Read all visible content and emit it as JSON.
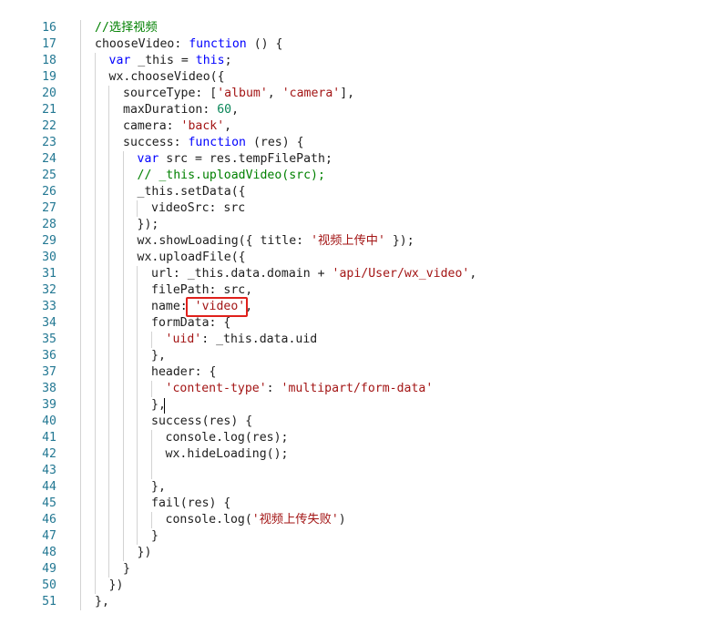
{
  "editor": {
    "lines": [
      {
        "num": "16",
        "indent": 0,
        "tokens": [
          {
            "t": "//选择视频",
            "c": "cm"
          }
        ]
      },
      {
        "num": "17",
        "indent": 0,
        "tokens": [
          {
            "t": "chooseVideo: ",
            "c": "txt"
          },
          {
            "t": "function",
            "c": "kw"
          },
          {
            "t": " () {",
            "c": "txt"
          }
        ]
      },
      {
        "num": "18",
        "indent": 1,
        "tokens": [
          {
            "t": "var",
            "c": "kw"
          },
          {
            "t": " _this = ",
            "c": "txt"
          },
          {
            "t": "this",
            "c": "kw"
          },
          {
            "t": ";",
            "c": "txt"
          }
        ]
      },
      {
        "num": "19",
        "indent": 1,
        "tokens": [
          {
            "t": "wx.chooseVideo({",
            "c": "txt"
          }
        ]
      },
      {
        "num": "20",
        "indent": 2,
        "tokens": [
          {
            "t": "sourceType: [",
            "c": "txt"
          },
          {
            "t": "'album'",
            "c": "str"
          },
          {
            "t": ", ",
            "c": "txt"
          },
          {
            "t": "'camera'",
            "c": "str"
          },
          {
            "t": "],",
            "c": "txt"
          }
        ]
      },
      {
        "num": "21",
        "indent": 2,
        "tokens": [
          {
            "t": "maxDuration: ",
            "c": "txt"
          },
          {
            "t": "60",
            "c": "num"
          },
          {
            "t": ",",
            "c": "txt"
          }
        ]
      },
      {
        "num": "22",
        "indent": 2,
        "tokens": [
          {
            "t": "camera: ",
            "c": "txt"
          },
          {
            "t": "'back'",
            "c": "str"
          },
          {
            "t": ",",
            "c": "txt"
          }
        ]
      },
      {
        "num": "23",
        "indent": 2,
        "tokens": [
          {
            "t": "success: ",
            "c": "txt"
          },
          {
            "t": "function",
            "c": "kw"
          },
          {
            "t": " (res) {",
            "c": "txt"
          }
        ]
      },
      {
        "num": "24",
        "indent": 3,
        "tokens": [
          {
            "t": "var",
            "c": "kw"
          },
          {
            "t": " src = res.tempFilePath;",
            "c": "txt"
          }
        ]
      },
      {
        "num": "25",
        "indent": 3,
        "tokens": [
          {
            "t": "// _this.uploadVideo(src);",
            "c": "cm"
          }
        ]
      },
      {
        "num": "26",
        "indent": 3,
        "tokens": [
          {
            "t": "_this.setData({",
            "c": "txt"
          }
        ]
      },
      {
        "num": "27",
        "indent": 4,
        "tokens": [
          {
            "t": "videoSrc: src",
            "c": "txt"
          }
        ]
      },
      {
        "num": "28",
        "indent": 3,
        "tokens": [
          {
            "t": "});",
            "c": "txt"
          }
        ]
      },
      {
        "num": "29",
        "indent": 3,
        "tokens": [
          {
            "t": "wx.showLoading({ title: ",
            "c": "txt"
          },
          {
            "t": "'视频上传中'",
            "c": "str"
          },
          {
            "t": " });",
            "c": "txt"
          }
        ]
      },
      {
        "num": "30",
        "indent": 3,
        "tokens": [
          {
            "t": "wx.uploadFile({",
            "c": "txt"
          }
        ]
      },
      {
        "num": "31",
        "indent": 4,
        "tokens": [
          {
            "t": "url: _this.data.domain + ",
            "c": "txt"
          },
          {
            "t": "'api/User/wx_video'",
            "c": "str"
          },
          {
            "t": ",",
            "c": "txt"
          }
        ]
      },
      {
        "num": "32",
        "indent": 4,
        "tokens": [
          {
            "t": "filePath: src,",
            "c": "txt"
          }
        ]
      },
      {
        "num": "33",
        "indent": 4,
        "tokens": [
          {
            "t": "name: ",
            "c": "txt"
          },
          {
            "t": "'video'",
            "c": "str"
          },
          {
            "t": ",",
            "c": "txt"
          }
        ]
      },
      {
        "num": "34",
        "indent": 4,
        "tokens": [
          {
            "t": "formData: {",
            "c": "txt"
          }
        ]
      },
      {
        "num": "35",
        "indent": 5,
        "tokens": [
          {
            "t": "'uid'",
            "c": "str"
          },
          {
            "t": ": _this.data.uid",
            "c": "txt"
          }
        ]
      },
      {
        "num": "36",
        "indent": 4,
        "tokens": [
          {
            "t": "},",
            "c": "txt"
          }
        ]
      },
      {
        "num": "37",
        "indent": 4,
        "tokens": [
          {
            "t": "header: {",
            "c": "txt"
          }
        ]
      },
      {
        "num": "38",
        "indent": 5,
        "tokens": [
          {
            "t": "'content-type'",
            "c": "str"
          },
          {
            "t": ": ",
            "c": "txt"
          },
          {
            "t": "'multipart/form-data'",
            "c": "str"
          }
        ]
      },
      {
        "num": "39",
        "indent": 4,
        "tokens": [
          {
            "t": "},",
            "c": "txt"
          }
        ]
      },
      {
        "num": "40",
        "indent": 4,
        "tokens": [
          {
            "t": "success(res) {",
            "c": "txt"
          }
        ]
      },
      {
        "num": "41",
        "indent": 5,
        "tokens": [
          {
            "t": "console.log(res);",
            "c": "txt"
          }
        ]
      },
      {
        "num": "42",
        "indent": 5,
        "tokens": [
          {
            "t": "wx.hideLoading();",
            "c": "txt"
          }
        ]
      },
      {
        "num": "43",
        "indent": 5,
        "tokens": []
      },
      {
        "num": "44",
        "indent": 4,
        "tokens": [
          {
            "t": "},",
            "c": "txt"
          }
        ]
      },
      {
        "num": "45",
        "indent": 4,
        "tokens": [
          {
            "t": "fail(res) {",
            "c": "txt"
          }
        ]
      },
      {
        "num": "46",
        "indent": 5,
        "tokens": [
          {
            "t": "console.log(",
            "c": "txt"
          },
          {
            "t": "'视频上传失败'",
            "c": "str"
          },
          {
            "t": ")",
            "c": "txt"
          }
        ]
      },
      {
        "num": "47",
        "indent": 4,
        "tokens": [
          {
            "t": "}",
            "c": "txt"
          }
        ]
      },
      {
        "num": "48",
        "indent": 3,
        "tokens": [
          {
            "t": "})",
            "c": "txt"
          }
        ]
      },
      {
        "num": "49",
        "indent": 2,
        "tokens": [
          {
            "t": "}",
            "c": "txt"
          }
        ]
      },
      {
        "num": "50",
        "indent": 1,
        "tokens": [
          {
            "t": "})",
            "c": "txt"
          }
        ]
      },
      {
        "num": "51",
        "indent": 0,
        "tokens": [
          {
            "t": "},",
            "c": "txt"
          }
        ]
      }
    ],
    "highlighted_token": "'video'",
    "colors": {
      "keyword": "#0000ff",
      "string": "#a31515",
      "number": "#098658",
      "comment": "#008000",
      "line_number": "#237893",
      "highlight_box": "#e0201b"
    }
  }
}
